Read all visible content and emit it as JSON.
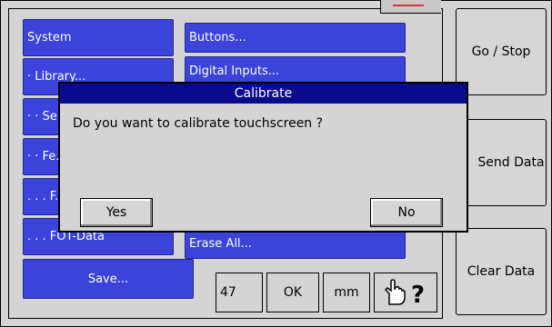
{
  "menu": {
    "left": [
      "System",
      "· Library...",
      "· · Se...",
      "· · Fe...",
      ". . . F...",
      ". . . FOT-Data"
    ],
    "right": [
      "Buttons...",
      "Digital Inputs..."
    ],
    "right_bottom": "Erase All...",
    "save": "Save..."
  },
  "side_buttons": {
    "go_stop": "Go / Stop",
    "send_data": "Send Data",
    "clear_data": "Clear Data"
  },
  "status": {
    "value": "47",
    "ok": "OK",
    "unit": "mm",
    "help_icon": "hand-pointer-question-icon"
  },
  "dialog": {
    "title": "Calibrate",
    "message": "Do you want to calibrate touchscreen ?",
    "yes": "Yes",
    "no": "No"
  },
  "colors": {
    "menu_blue": "#3b43db",
    "title_navy": "#0a0a8c",
    "panel_gray": "#d4d4d4"
  }
}
